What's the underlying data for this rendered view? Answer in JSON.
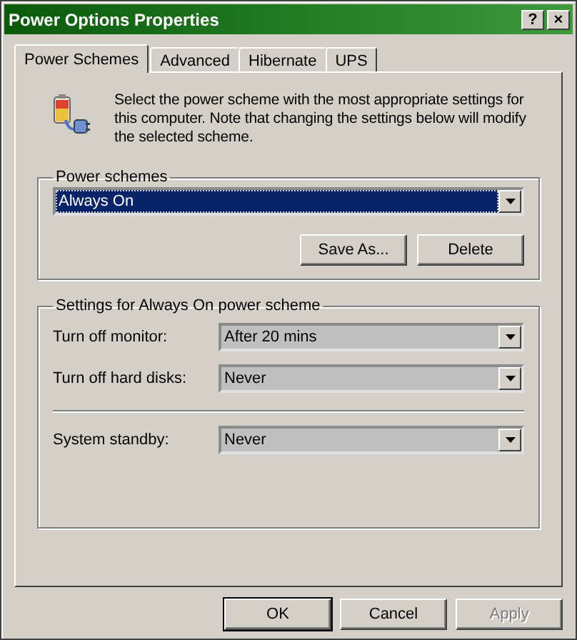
{
  "window": {
    "title": "Power Options Properties",
    "buttons": [
      "?",
      "×"
    ]
  },
  "tabs": [
    {
      "label": "Power Schemes",
      "selected": true
    },
    {
      "label": "Advanced",
      "selected": false
    },
    {
      "label": "Hibernate",
      "selected": false
    },
    {
      "label": "UPS",
      "selected": false
    }
  ],
  "intro": "Select the power scheme with the most appropriate settings for this computer. Note that changing the settings below will modify the selected scheme.",
  "power_schemes": {
    "label": "Power schemes",
    "value": "Always On",
    "focused": true,
    "buttons": [
      {
        "label": "Save As...",
        "disabled": false
      },
      {
        "label": "Delete",
        "disabled": false
      }
    ]
  },
  "settings": {
    "label": "Settings for Always On power scheme",
    "rows": [
      {
        "label": "Turn off monitor:",
        "value": "After 20 mins",
        "separator_after": false
      },
      {
        "label": "Turn off hard disks:",
        "value": "Never",
        "separator_after": true
      },
      {
        "label": "System standby:",
        "value": "Never",
        "separator_after": false
      }
    ]
  },
  "footer_buttons": [
    {
      "label": "OK",
      "default": true,
      "disabled": false
    },
    {
      "label": "Cancel",
      "default": false,
      "disabled": false
    },
    {
      "label": "Apply",
      "default": false,
      "disabled": true
    }
  ]
}
